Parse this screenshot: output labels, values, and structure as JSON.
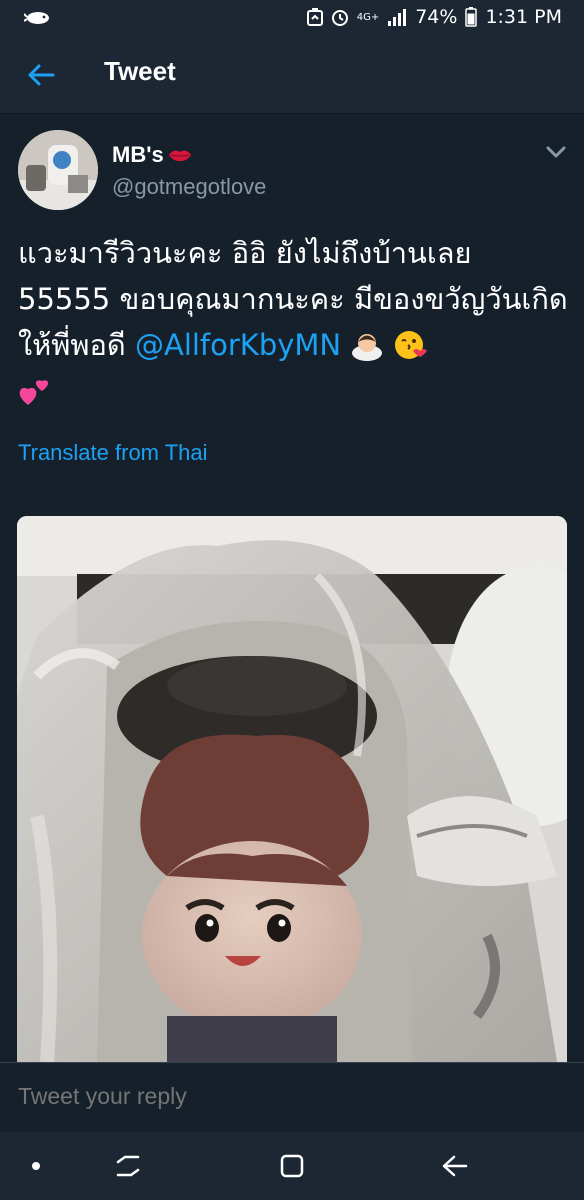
{
  "status_bar": {
    "network": "4G+",
    "battery": "74%",
    "time": "1:31 PM"
  },
  "header": {
    "title": "Tweet"
  },
  "tweet": {
    "author_name": "MB's",
    "author_handle": "@gotmegotlove",
    "text_part1": "แวะมารีวิวนะคะ อิอิ ยังไม่ถึงบ้านเลย 55555 ขอบคุณมากนะคะ มีของขวัญวันเกิดให้พี่พอดี ",
    "mention": "@AllforKbyMN",
    "translate_label": "Translate from Thai"
  },
  "reply": {
    "placeholder": "Tweet your reply"
  },
  "icons": {
    "status_left": "notification-icon",
    "back": "back-arrow-icon",
    "more": "chevron-down-icon",
    "emoji1": "person-bowing-emoji",
    "emoji2": "face-blowing-kiss-emoji",
    "emoji3": "two-hearts-emoji",
    "nav_dot": "nav-dot-icon",
    "nav_recents": "recent-apps-icon",
    "nav_home": "home-icon",
    "nav_back": "back-icon"
  },
  "colors": {
    "background": "#15202b",
    "bar": "#1c2733",
    "accent": "#1da1f2",
    "secondary_text": "#8899a6"
  }
}
